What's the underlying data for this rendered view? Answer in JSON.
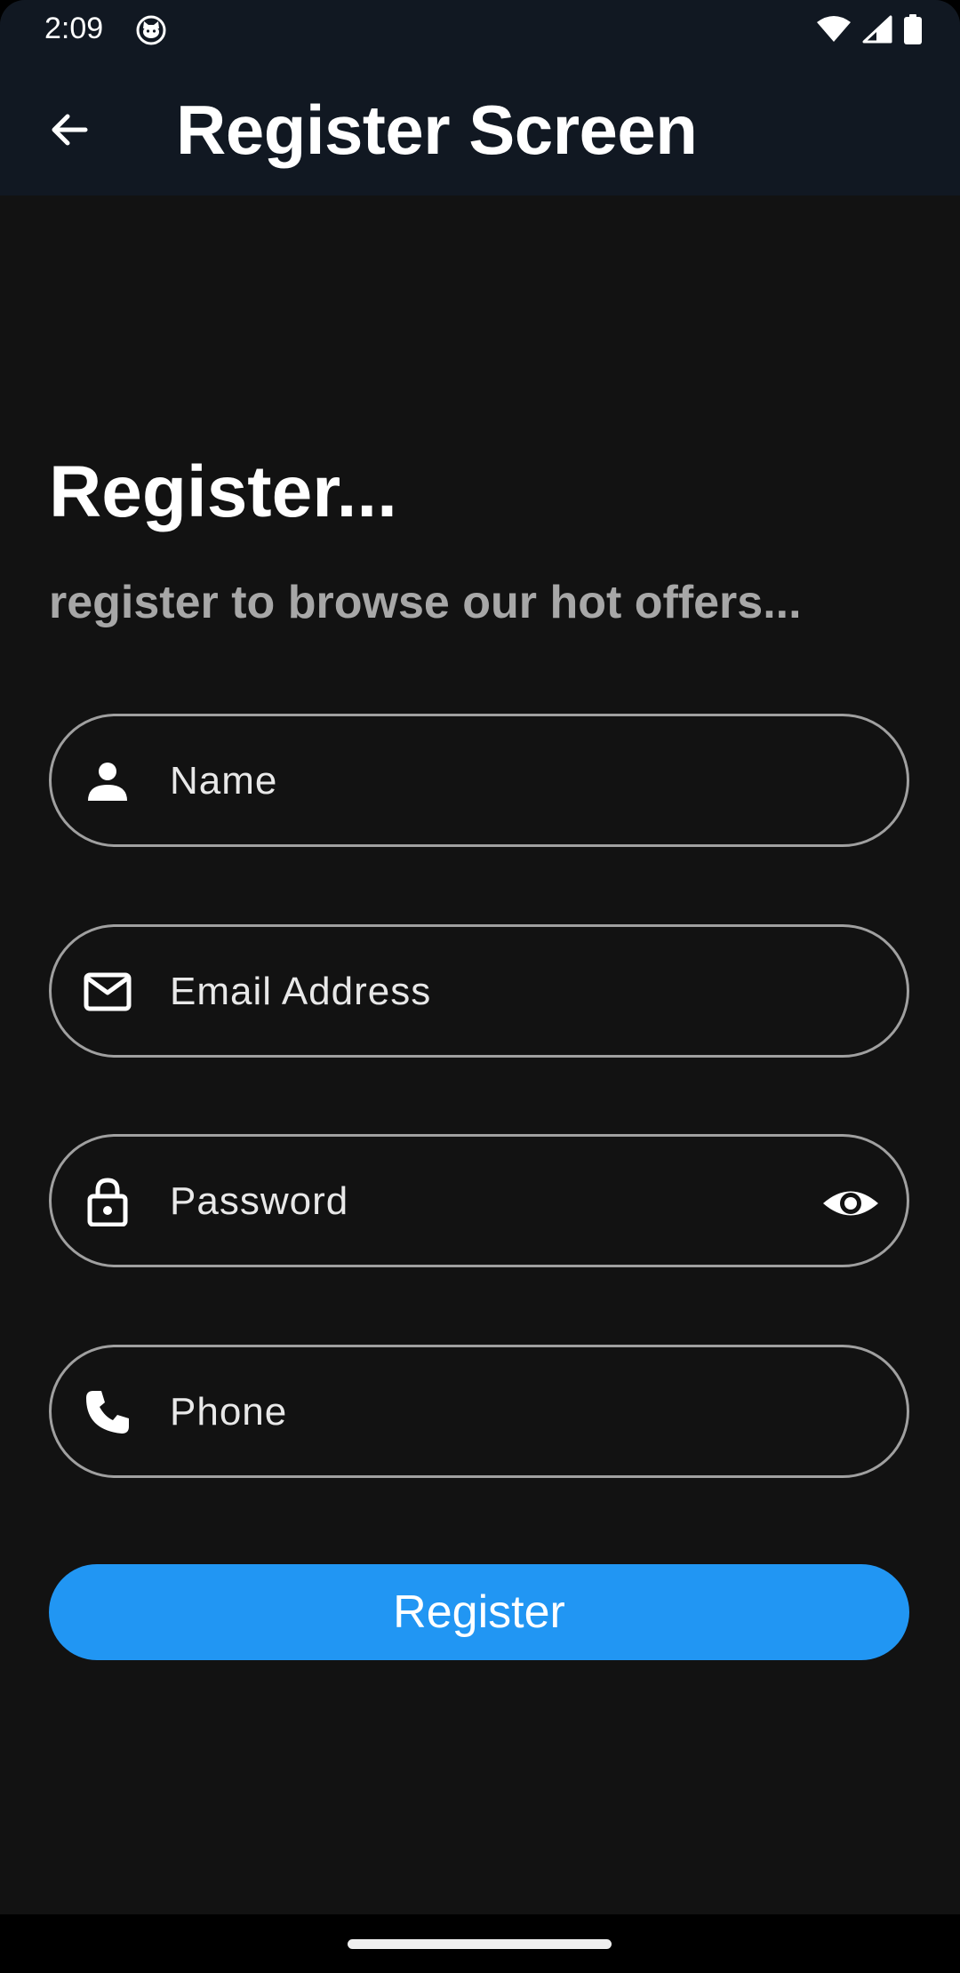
{
  "status_bar": {
    "time": "2:09",
    "icons": [
      "cat-notification-icon",
      "wifi-icon",
      "signal-icon",
      "battery-icon"
    ]
  },
  "app_bar": {
    "back_icon": "arrow-back-icon",
    "title": "Register Screen"
  },
  "main": {
    "heading": "Register...",
    "subheading": "register to browse our hot offers...",
    "fields": [
      {
        "icon": "person-icon",
        "label": "Name"
      },
      {
        "icon": "mail-icon",
        "label": "Email Address"
      },
      {
        "icon": "lock-icon",
        "label": "Password",
        "trailing_icon": "eye-icon"
      },
      {
        "icon": "phone-icon",
        "label": "Phone"
      }
    ],
    "register_label": "Register"
  },
  "colors": {
    "background": "#121212",
    "app_bar": "#111822",
    "accent": "#2196f3",
    "field_border": "#a0a0a0",
    "subheading": "#a7a7a7"
  }
}
